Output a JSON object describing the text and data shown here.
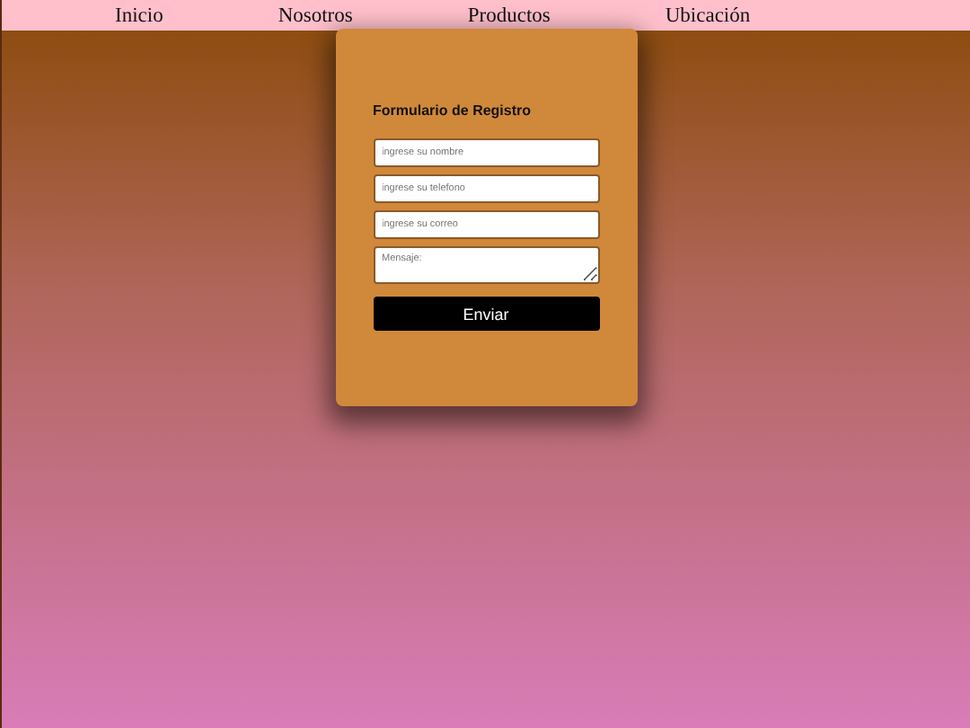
{
  "nav": {
    "items": [
      "Inicio",
      "Nosotros",
      "Productos",
      "Ubicación"
    ]
  },
  "form": {
    "title": "Formulario de Registro",
    "fields": [
      {
        "kind": "input",
        "placeholder": "ingrese su nombre"
      },
      {
        "kind": "input",
        "placeholder": "ingrese su telefono"
      },
      {
        "kind": "input",
        "placeholder": "ingrese su correo"
      },
      {
        "kind": "textarea",
        "placeholder": "Mensaje:"
      }
    ],
    "submit": "Enviar"
  }
}
